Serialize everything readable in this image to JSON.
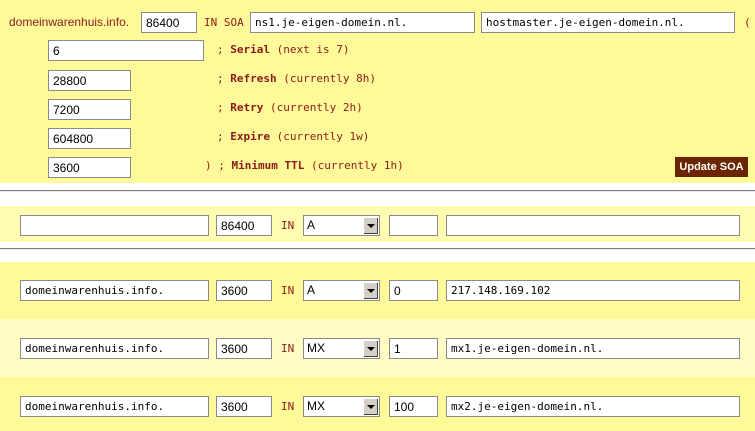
{
  "soa": {
    "zone_label": "domeinwarenhuis.info.",
    "ttl": "86400",
    "in_soa": "IN SOA",
    "primary_ns": "ns1.je-eigen-domein.nl.",
    "hostmaster": "hostmaster.je-eigen-domein.nl.",
    "open_paren": "(",
    "serial": {
      "value": "6",
      "prefix": ";",
      "label": "Serial",
      "note": "(next is 7)"
    },
    "refresh": {
      "value": "28800",
      "prefix": ";",
      "label": "Refresh",
      "note": "(currently 8h)"
    },
    "retry": {
      "value": "7200",
      "prefix": ";",
      "label": "Retry",
      "note": "(currently 2h)"
    },
    "expire": {
      "value": "604800",
      "prefix": ";",
      "label": "Expire",
      "note": "(currently 1w)"
    },
    "minimum": {
      "value": "3600",
      "prefix": ") ;",
      "label": "Minimum TTL",
      "note": "(currently 1h)"
    },
    "update_button": "Update SOA"
  },
  "new_record": {
    "name": "",
    "ttl": "86400",
    "in": "IN",
    "type": "A",
    "priority": "",
    "data": ""
  },
  "records": [
    {
      "name": "domeinwarenhuis.info.",
      "ttl": "3600",
      "in": "IN",
      "type": "A",
      "priority": "0",
      "data": "217.148.169.102"
    },
    {
      "name": "domeinwarenhuis.info.",
      "ttl": "3600",
      "in": "IN",
      "type": "MX",
      "priority": "1",
      "data": "mx1.je-eigen-domein.nl."
    },
    {
      "name": "domeinwarenhuis.info.",
      "ttl": "3600",
      "in": "IN",
      "type": "MX",
      "priority": "100",
      "data": "mx2.je-eigen-domein.nl."
    }
  ],
  "colors": {
    "soa_bg": "#fffa99",
    "label_text": "#8b1a1a",
    "button_bg": "#6b2500"
  }
}
